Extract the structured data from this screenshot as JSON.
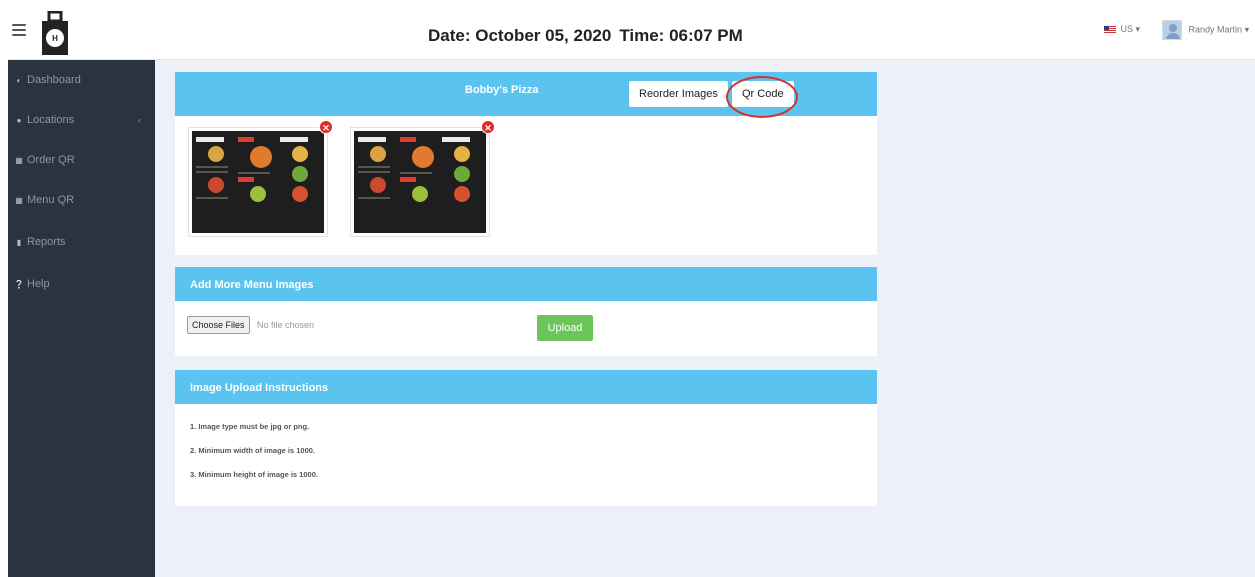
{
  "topbar": {
    "title_date": "Date: October 05, 2020",
    "title_time": "Time: 06:07 PM",
    "language": "US",
    "user_name": "Randy Martin"
  },
  "sidebar": {
    "items": [
      {
        "icon": "dashboard-icon",
        "label": "Dashboard"
      },
      {
        "icon": "map-marker-icon",
        "label": "Locations",
        "has_caret": true
      },
      {
        "icon": "list-icon",
        "label": "Order QR"
      },
      {
        "icon": "list-icon",
        "label": "Menu QR"
      },
      {
        "icon": "file-icon",
        "label": "Reports"
      },
      {
        "icon": "question-circle-icon",
        "label": "Help"
      }
    ]
  },
  "menu_panel": {
    "title": "Bobby's Pizza",
    "reorder_label": "Reorder Images",
    "qr_label": "Qr Code"
  },
  "menu_images": [
    {
      "alt": "menu-image-1"
    },
    {
      "alt": "menu-image-2"
    }
  ],
  "upload_panel": {
    "title": "Add More Menu Images",
    "choose_label": "Choose Files",
    "no_file_text": "No file chosen",
    "upload_label": "Upload"
  },
  "instructions_panel": {
    "title": "Image Upload Instructions",
    "items": [
      "1. Image type must be jpg or png.",
      "2. Minimum width of image is 1000.",
      "3. Minimum height of image is 1000."
    ]
  },
  "colors": {
    "sidebar_bg": "#2a3440",
    "panel_header": "#5bc3ef",
    "upload_button": "#6cc55b",
    "delete_icon": "#e02b2b",
    "highlight_circle": "#d9312a",
    "content_bg": "#eef0f7"
  }
}
